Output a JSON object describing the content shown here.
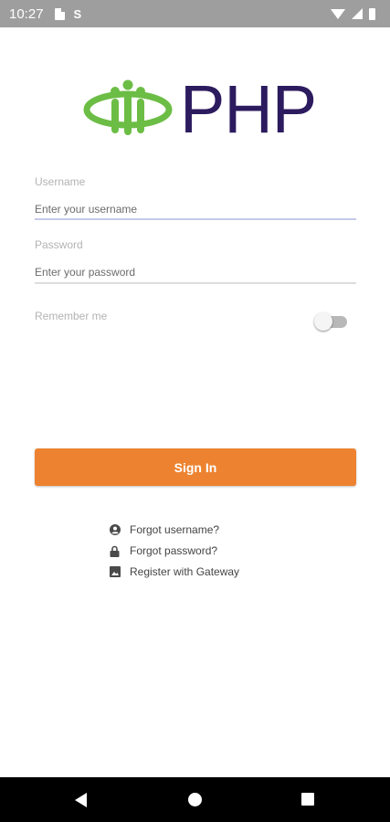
{
  "status_bar": {
    "time": "10:27",
    "s_icon": "S"
  },
  "logo": {
    "text": "PHP",
    "colors": {
      "green": "#6cbd45",
      "purple": "#2c1b5e"
    }
  },
  "form": {
    "username": {
      "label": "Username",
      "placeholder": "Enter your username",
      "value": ""
    },
    "password": {
      "label": "Password",
      "placeholder": "Enter your password",
      "value": ""
    },
    "remember_me": {
      "label": "Remember me",
      "checked": false
    }
  },
  "signin_button": {
    "label": "Sign In",
    "color": "#ed8330"
  },
  "links": [
    {
      "label": "Forgot username?",
      "icon": "account-circle-icon"
    },
    {
      "label": "Forgot password?",
      "icon": "lock-icon"
    },
    {
      "label": "Register with Gateway",
      "icon": "image-icon"
    }
  ],
  "nav_bar": {
    "icons": [
      "back-triangle-icon",
      "home-circle-icon",
      "recents-square-icon"
    ]
  },
  "colors": {
    "status_bar": "#9e9e9e",
    "accent_underline": "#c5cae9",
    "underline": "#dddddd"
  }
}
